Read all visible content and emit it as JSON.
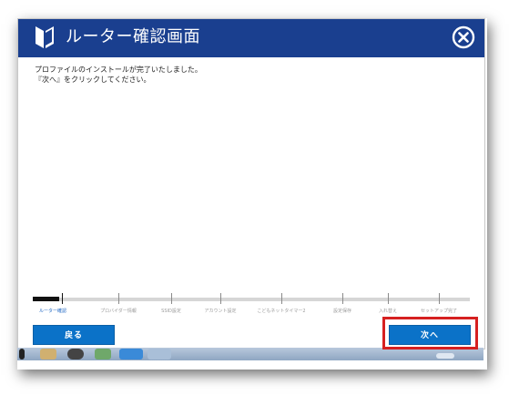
{
  "window": {
    "title": "ルーター確認画面"
  },
  "message": {
    "line1": "プロファイルのインストールが完了いたしました。",
    "line2": "『次へ』をクリックしてください。"
  },
  "progress": {
    "fraction": 0.06,
    "steps": [
      {
        "label": "ルーター確認",
        "active": true
      },
      {
        "label": "プロバイダー情報",
        "active": false
      },
      {
        "label": "SSID設定",
        "active": false
      },
      {
        "label": "アカウント設定",
        "active": false
      },
      {
        "label": "こどもネットタイマー2",
        "active": false
      },
      {
        "label": "設定保存",
        "active": false
      },
      {
        "label": "入れ替え",
        "active": false
      },
      {
        "label": "セットアップ完了",
        "active": false
      }
    ]
  },
  "buttons": {
    "back_label": "戻る",
    "next_label": "次へ"
  },
  "colors": {
    "titlebar": "#1a3f8f",
    "button": "#0b72c8",
    "highlight": "#d62020"
  },
  "icons": {
    "title": "beginner-mark-icon",
    "close": "close-circle-icon"
  }
}
